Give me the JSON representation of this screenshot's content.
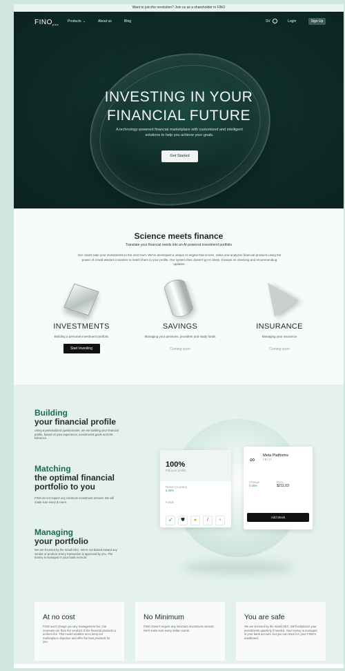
{
  "announcement": "Want to join the revolution? Join us as a shareholder in FINO",
  "nav": {
    "logo": "FINO",
    "logo_suffix": "plus",
    "links": [
      {
        "label": "Products",
        "has_dropdown": true
      },
      {
        "label": "About us",
        "has_dropdown": false
      },
      {
        "label": "Blog",
        "has_dropdown": false
      }
    ],
    "language": "SV",
    "login": "Login",
    "signup": "Sign Up"
  },
  "hero": {
    "title_line1": "INVESTING IN YOUR",
    "title_line2": "FINANCIAL FUTURE",
    "subtitle": "A technology-powered financial marketplace with customized and intelligent solutions to help you achieve your goals.",
    "cta": "Get Started"
  },
  "science": {
    "title": "Science meets finance",
    "subtitle": "Translate your financial needs into an AI-powered investment portfolio",
    "description": "Our robots take your investments to the next level. We've developed a unique AI engine that scores, ranks and analyzes financial products using the power of crowd-wisdom investors to match them to your profile. Our system then doesn't go to sleep. It keeps on checking and recommending updates.",
    "products": [
      {
        "title": "INVESTMENTS",
        "subtitle": "Building a personal investment portfolio",
        "action": "Start Investing",
        "shape": "cube"
      },
      {
        "title": "SAVINGS",
        "subtitle": "Managing your pensions, provident and study funds",
        "action": "Coming soon",
        "shape": "cylinder"
      },
      {
        "title": "INSURANCE",
        "subtitle": "Managing your insurance",
        "action": "Coming soon",
        "shape": "cone"
      }
    ]
  },
  "profile": {
    "blocks": [
      {
        "accent": "Building",
        "rest": "your financial profile",
        "text": "Using a personalized questionnaire, we are building your financial profile, based on your experience, investments goals and risk tolerance."
      },
      {
        "accent": "Matching",
        "rest": "the optimal financial portfolio to you",
        "text": "FINO do not require any minimum investment amount. We will make sure every $ count."
      },
      {
        "accent": "Managing",
        "rest": "your portfolio",
        "text": "We are licensed by the Israeli SEC. We're not biased toward any vendor or product. Every transaction is approved by you. The money is managed in your bank account."
      }
    ],
    "fit_card": {
      "percent": "100%",
      "label": "Fits your profile",
      "return_label": "Return (3 years)",
      "return_value": "5.45%",
      "funds_label": "Funds"
    },
    "stock_card": {
      "name": "Meta Platforms",
      "ticker": "FB | IT",
      "change_label": "Change",
      "change_value": "0.05%",
      "price_label": "Price",
      "price_value": "$211.03",
      "button": "Add Stock"
    }
  },
  "features": [
    {
      "title": "At no cost",
      "text": "FINO won't charge you any management fee. Our revenues are from the vendors of the financial products a uniform fee. This model enables us to keep our marketplace objective and offer the best products for you."
    },
    {
      "title": "No Minimum",
      "text": "FINO doesn't require any minimum investment amount. We'll make sure every dollar counts."
    },
    {
      "title": "You are safe",
      "text": "We are licensed by the Israeli SEC. We'll rebalance your investments quarterly if needed. Your money is managed in your bank account, but you can track it in your FINO's dashboard."
    }
  ]
}
